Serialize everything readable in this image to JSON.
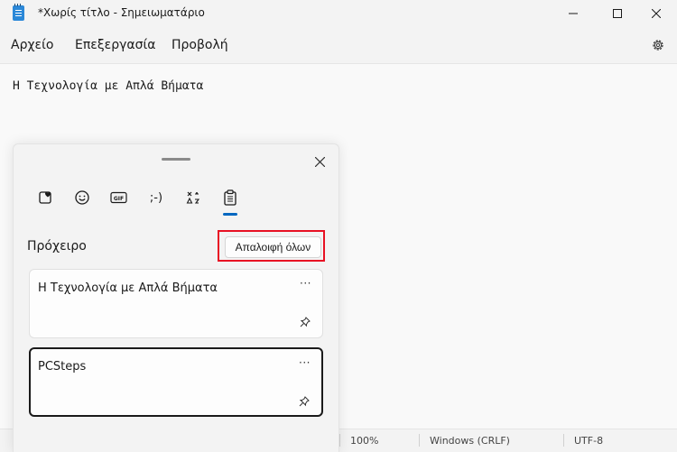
{
  "window": {
    "title": "*Χωρίς τίτλο - Σημειωματάριο"
  },
  "menu": {
    "items": [
      {
        "label": "Αρχείο"
      },
      {
        "label": "Επεξεργασία"
      },
      {
        "label": "Προβολή"
      }
    ]
  },
  "editor": {
    "content": "Η Τεχνολογία με Απλά Βήματα"
  },
  "status": {
    "zoom": "100%",
    "line_ending": "Windows (CRLF)",
    "encoding": "UTF-8"
  },
  "clipboard_panel": {
    "tabs": [
      {
        "icon": "heart-emoji-icon"
      },
      {
        "icon": "smiley-icon"
      },
      {
        "icon": "gif-icon",
        "label": "GIF"
      },
      {
        "icon": "kaomoji-icon",
        "label": ";-)"
      },
      {
        "icon": "symbols-icon"
      },
      {
        "icon": "clipboard-icon",
        "selected": true
      }
    ],
    "heading": "Πρόχειρο",
    "clear_all_label": "Απαλοιφή όλων",
    "items": [
      {
        "text": "Η Τεχνολογία με Απλά Βήματα",
        "more": "···",
        "selected": false
      },
      {
        "text": "PCSteps",
        "more": "···",
        "selected": true
      }
    ]
  },
  "colors": {
    "accent": "#0067c0",
    "highlight": "#e81123",
    "app_icon": "#2b88d8"
  }
}
